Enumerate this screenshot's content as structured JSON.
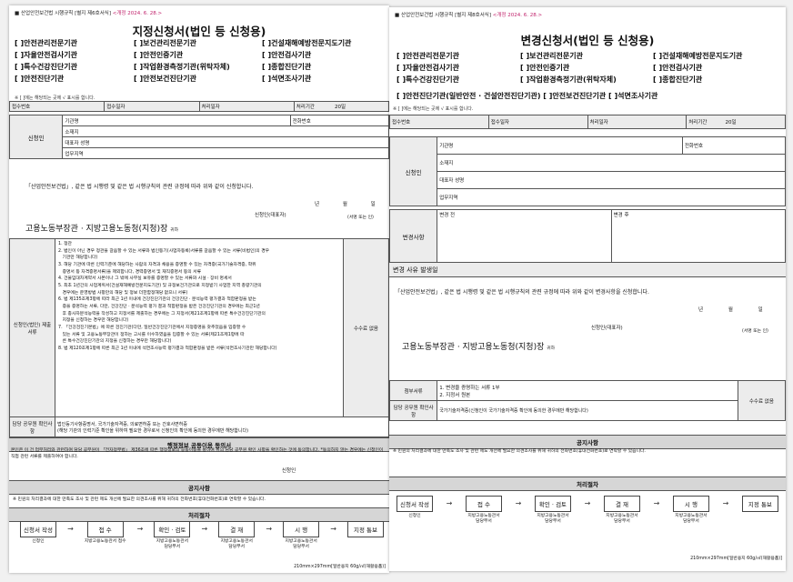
{
  "docA": {
    "header_prefix": "■ 산업안전보건법 시행규칙 [별지 제6호서식]",
    "header_date": "<개정 2024. 6. 28.>",
    "title": "지정신청서(법인 등 신청용)",
    "types": [
      "[ ]안전관리전문기관",
      "[ ]보건관리전문기관",
      "[ ]건설재해예방전문지도기관",
      "[ ]자율안전검사기관",
      "[ ]안전인증기관",
      "[ ]안전검사기관",
      "[ ]특수건강진단기관",
      "[ ]작업환경측정기관(위탁자체)",
      "[ ]종합진단기관",
      "[ ]안전진단기관",
      "[ ]안전보건진단기관",
      "[ ]석면조사기관"
    ],
    "note": "※ [ ]에는 해당되는 곳에 √ 표시를 합니다.",
    "receipt": {
      "no": "접수번호",
      "date": "접수일자",
      "proc_date": "처리일자",
      "period": "처리기간",
      "days": "20일"
    },
    "applicant": {
      "label": "신청인",
      "company": "기관명",
      "phone": "전화번호",
      "address": "소재지",
      "rep": "대표자 성명",
      "business": "업무지역"
    },
    "statement": "「산업안전보건법」, 같은 법 시행령 및 같은 법 시행규칙의 관련 규정에 따라 위와 같이 신청합니다.",
    "ymd": [
      "년",
      "월",
      "일"
    ],
    "signer": "신청인(대표자)",
    "sign_note": "(서명 또는 인)",
    "agency": "고용노동부장관 · 지방고용노동청(지청)장",
    "agency_suffix": "귀하",
    "docs_label": "신청인(법인) 제출서류",
    "fee_label": "수수료 없음",
    "docs": [
      "1. 정관",
      "2. 법인이 아닌 경우 정관을 갈음할 수 있는 서류와 법인등기(사업자등록)서류를 갈음할 수 있는 서류(비법인)의 경우",
      "   기관만 해당합니다)",
      "3. 해당 기관에 따른 인력기준에 해당하는 사람의 자격과 채용을 증명할 수 있는 자격증(국가기술자격증, 학위",
      "   증명서 등 자격증명서류)을 제외합니다, 경력증명서 및 재직증명서 등의 서류",
      "4. 건물임대차계약서 사본이나 그 밖에 사무실 보유를 증명할 수 있는 서류와 시설 · 장비 명세서",
      "5. 최초 1년간의 사업계획서(건설재해예방전문지도기관) 및 규정보건기관으로 지정받기 사업한 지역 총량기관의",
      "   경우에는 운영방법 사항만의 해당 및 정보 더한함정해당 없으니 서류)",
      "6. 법 제135조제3항에 따라 최근 1년 이내에 건강진단기관의 건강진단 · 분석능력 평가결과 적합판정을 받는",
      "   증을 증명하는 서류, 다만, 건강진단 · 분석능력 평가 결과 적합판정을 받은 건강진단기관의 경우에는 최근1년",
      "   후 종사자분석능력을 작성하고 지정서를 제출하는 경우에는 그 지정서(제21조제1항에 따른 특수건강진단기관의",
      "   지정을 신청하는 경우만 해당합니다)",
      "7. 「건강검진기본법」에 따른 검진기관(다만, 일반건강진단기관에서 지정증명을 갖추었음을 입증할 수",
      "   있는 서류 및 고용노동부장관이 정하는 고시를 이수하였음을 입증할 수 있는 서류(제21조제1항에 따",
      "   른 특수건강진단기관의 지정을 신청하는 경우만 해당합니다)",
      "8. 법 제120조제1항에 따른 최근 1년 이내에 석면조사능력 평가결과 적합판정을 받은 서류(석면조사기관만 해당합니다)"
    ],
    "check_label": "담당 공무원 확인사항",
    "check_text": "법인등기사항증명서, 국가기술자격증, 의료면허증 또는 간호사면허증\n(해당 기관의 인력기준 확인을 위하여 필요한 경우로서 신청인의 확인에 동의한 경우에만 해당합니다)",
    "info_title": "행정정보 공동이용 동의서",
    "info_text": "본인은 이 건 업무처리와 관련하여 담당 공무원이 「전자정부법」 제36조에 따른 행정정보의 공동이용을 통하여 위의 담당 공무원 확인 사항을 확인하는 것에 동의합니다. *동의하지 않는 경우에는 신청인이 직접 관련 서류를 제출하여야 합니다.",
    "info_sign": "신청인",
    "notice_title": "공지사항",
    "notice_text": "※ 민원의 처리결과에 대한 만족도 조사 및 관련 제도 개선에 필요한 의견조사를 위해 귀하의 전화번호(휴대전화번호)로 연락할 수 있습니다.",
    "proc_title": "처리절차",
    "flow": [
      {
        "box": "신청서 작성",
        "cap": "신청인"
      },
      {
        "box": "접 수",
        "cap": "지방고용노동관서 접수"
      },
      {
        "box": "확인 · 검토",
        "cap": "지방고용노동관서\n담당부서"
      },
      {
        "box": "결 재",
        "cap": "지방고용노동관서\n담당부서"
      },
      {
        "box": "시 행",
        "cap": "지방고용노동관서\n담당부서"
      },
      {
        "box": "지정 통보",
        "cap": ""
      }
    ],
    "footer": "210mm×297mm[일반용지 60g/㎡(재활용품)]"
  },
  "docB": {
    "header_prefix": "■ 산업안전보건법 시행규칙 [별지 제8호서식]",
    "header_date": "<개정 2024. 6. 28.>",
    "title": "변경신청서(법인 등 신청용)",
    "types": [
      "[ ]안전관리전문기관",
      "[ ]보건관리전문기관",
      "[ ]건설재해예방전문지도기관",
      "[ ]자율안전검사기관",
      "[ ]안전인증기관",
      "[ ]안전검사기관",
      "[ ]특수건강진단기관",
      "[ ]작업환경측정기관(위탁자체)",
      "[ ]종합진단기관"
    ],
    "types_last": "[ ]안전진단기관(일반안전 · 건설안전진단기관) [ ]안전보건진단기관 [ ]석면조사기관",
    "note": "※ [ ]에는 해당되는 곳에 √ 표시를 합니다.",
    "receipt": {
      "no": "접수번호",
      "date": "접수일자",
      "proc_date": "처리일자",
      "period": "처리기간",
      "days": "20일"
    },
    "applicant": {
      "label": "신청인",
      "company": "기관명",
      "phone": "전화번호",
      "address": "소재지",
      "rep": "대표자 성명",
      "business": "업무지역"
    },
    "change": {
      "label": "변경사항",
      "before": "변경 전",
      "after": "변경 후"
    },
    "reason": "변경 사유 발생일",
    "statement": "「산업안전보건법」, 같은 법 시행령 및 같은 법 시행규칙의 관련 규정에 따라 위와 같이 변경사항을 신청합니다.",
    "ymd": [
      "년",
      "월",
      "일"
    ],
    "signer": "신청인(대표자)",
    "sign_note": "(서명 또는 인)",
    "agency": "고용노동부장관 · 지방고용노동청(지청)장",
    "agency_suffix": "귀하",
    "docs_label": "첨부서류",
    "docs": [
      "1. 변경을 증명하는 서류 1부",
      "2. 지정서 원본"
    ],
    "check_label": "담당 공무원 확인사항",
    "check_text": "국가기술자격증(신청인이 국가기술자격증 확인에 동의한 경우에만 해당합니다)",
    "fee_label": "수수료 없음",
    "notice_title": "공지사항",
    "notice_text": "※ 민원의 처리결과에 대한 만족도 조사 및 관련 제도 개선에 필요한 의견조사를 위해 귀하의 전화번호(휴대전화번호)로 연락할 수 있습니다.",
    "proc_title": "처리절차",
    "flow": [
      {
        "box": "신청서 작성",
        "cap": "신청인"
      },
      {
        "box": "접 수",
        "cap": "지방고용노동관서\n담당부서"
      },
      {
        "box": "확인 · 검토",
        "cap": "지방고용노동관서\n담당부서"
      },
      {
        "box": "결 재",
        "cap": "지방고용노동관서\n담당부서"
      },
      {
        "box": "시 행",
        "cap": "지방고용노동관서\n담당부서"
      },
      {
        "box": "지정 통보",
        "cap": ""
      }
    ],
    "footer": "210mm×297mm[일반용지 60g/㎡(재활용품)]"
  }
}
